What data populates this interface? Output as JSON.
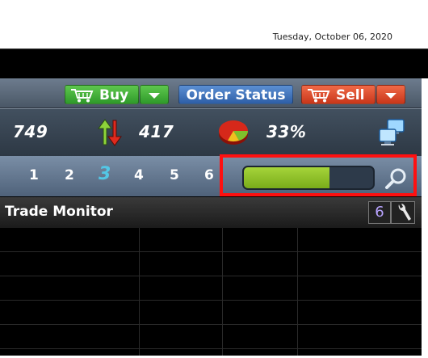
{
  "header": {
    "date": "Tuesday, October 06, 2020"
  },
  "toolbar": {
    "buy_label": "Buy",
    "order_status_label": "Order Status",
    "sell_label": "Sell"
  },
  "stats": {
    "value_1": "749",
    "value_2": "417",
    "value_3": "33%"
  },
  "pages": {
    "items": [
      "1",
      "2",
      "3",
      "4",
      "5",
      "6"
    ],
    "active": "3"
  },
  "progress": {
    "fraction": 0.66
  },
  "monitor": {
    "title": "Trade Monitor",
    "count": "6"
  },
  "icons": {
    "cart": "cart-icon",
    "updown": "up-down-arrows-icon",
    "pie": "pie-chart-icon",
    "network": "network-computers-icon",
    "search": "magnifier-icon",
    "wrench": "wrench-icon"
  },
  "colors": {
    "buy": "#3aa92f",
    "order_status": "#3f74bd",
    "sell": "#d9452a",
    "progress_fill": "#8fc12a",
    "highlight": "#ff1010",
    "active_page": "#53c7e6"
  }
}
